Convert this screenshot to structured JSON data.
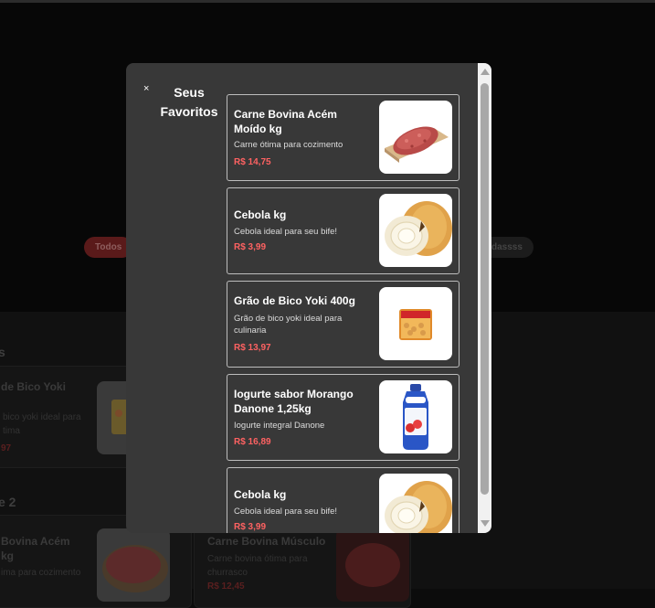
{
  "background": {
    "chip_all": "Todos",
    "chip_right": "dassss",
    "section1_heading": "s",
    "section2_heading": "e 2",
    "card1": {
      "title": "de Bico Yoki",
      "desc_line1": "bico yoki ideal para",
      "desc_line2": "tima",
      "price": "97"
    },
    "card2": {
      "title": "Bovina Acém",
      "title_line2": "kg",
      "desc": "ima para cozimento"
    },
    "card3": {
      "title": "Carne Bovina Músculo",
      "desc_line1": "Carne bovina ótima para",
      "desc_line2": "churrasco",
      "price": "R$ 12,45"
    }
  },
  "modal": {
    "close_label": "×",
    "title": "Seus Favoritos",
    "items": [
      {
        "title": "Carne Bovina Acém Moído kg",
        "desc": "Carne ótima para cozimento",
        "price": "R$ 14,75",
        "image": "ground-beef"
      },
      {
        "title": "Cebola kg",
        "desc": "Cebola ideal para seu bife!",
        "price": "R$ 3,99",
        "image": "onion"
      },
      {
        "title": "Grão de Bico Yoki 400g",
        "desc": "Grão de bico yoki ideal para culinaria",
        "price": "R$ 13,97",
        "image": "chickpea-pack"
      },
      {
        "title": "Iogurte sabor Morango Danone 1,25kg",
        "desc": "Iogurte integral Danone",
        "price": "R$ 16,89",
        "image": "yogurt-bottle"
      },
      {
        "title": "Cebola kg",
        "desc": "Cebola ideal para seu bife!",
        "price": "R$ 3,99",
        "image": "onion"
      }
    ]
  },
  "colors": {
    "price": "#ff6262",
    "modal_bg": "#383838",
    "page_bg": "#0c0c0c"
  }
}
